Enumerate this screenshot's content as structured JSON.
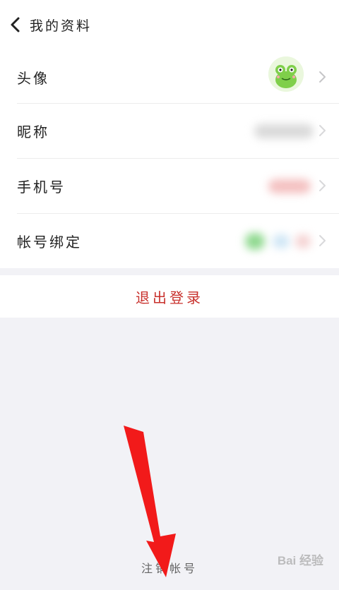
{
  "nav": {
    "title": "我的资料",
    "back_icon": "chevron-left-icon"
  },
  "rows": [
    {
      "label": "头像",
      "value_type": "avatar"
    },
    {
      "label": "昵称",
      "value_type": "blurred"
    },
    {
      "label": "手机号",
      "value_type": "blurred"
    },
    {
      "label": "帐号绑定",
      "value_type": "blurred"
    }
  ],
  "logout_label": "退出登录",
  "cancel_account_label": "注销帐号",
  "watermark": "Bai 经验",
  "colors": {
    "logout": "#c8302c",
    "arrow": "#f21a1a",
    "background": "#f2f2f6"
  }
}
